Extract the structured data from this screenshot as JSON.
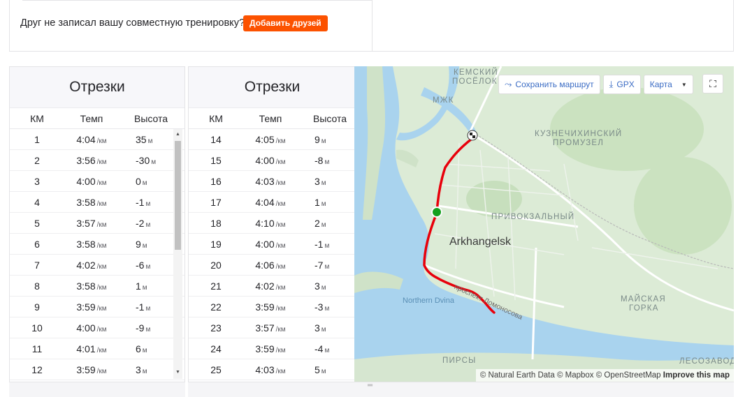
{
  "friend": {
    "prompt": "Друг не записал вашу совместную тренировку?",
    "button_label": "Добавить друзей"
  },
  "splits": {
    "title": "Отрезки",
    "columns": {
      "km": "КМ",
      "pace": "Темп",
      "elevation": "Высота"
    },
    "pace_unit": "/км",
    "elev_unit": "м",
    "left_rows": [
      {
        "km": "1",
        "pace": "4:04",
        "elev": "35"
      },
      {
        "km": "2",
        "pace": "3:56",
        "elev": "-30"
      },
      {
        "km": "3",
        "pace": "4:00",
        "elev": "0"
      },
      {
        "km": "4",
        "pace": "3:58",
        "elev": "-1"
      },
      {
        "km": "5",
        "pace": "3:57",
        "elev": "-2"
      },
      {
        "km": "6",
        "pace": "3:58",
        "elev": "9"
      },
      {
        "km": "7",
        "pace": "4:02",
        "elev": "-6"
      },
      {
        "km": "8",
        "pace": "3:58",
        "elev": "1"
      },
      {
        "km": "9",
        "pace": "3:59",
        "elev": "-1"
      },
      {
        "km": "10",
        "pace": "4:00",
        "elev": "-9"
      },
      {
        "km": "11",
        "pace": "4:01",
        "elev": "6"
      },
      {
        "km": "12",
        "pace": "3:59",
        "elev": "3"
      }
    ],
    "right_rows": [
      {
        "km": "14",
        "pace": "4:05",
        "elev": "9"
      },
      {
        "km": "15",
        "pace": "4:00",
        "elev": "-8"
      },
      {
        "km": "16",
        "pace": "4:03",
        "elev": "3"
      },
      {
        "km": "17",
        "pace": "4:04",
        "elev": "1"
      },
      {
        "km": "18",
        "pace": "4:10",
        "elev": "2"
      },
      {
        "km": "19",
        "pace": "4:00",
        "elev": "-1"
      },
      {
        "km": "20",
        "pace": "4:06",
        "elev": "-7"
      },
      {
        "km": "21",
        "pace": "4:02",
        "elev": "3"
      },
      {
        "km": "22",
        "pace": "3:59",
        "elev": "-3"
      },
      {
        "km": "23",
        "pace": "3:57",
        "elev": "3"
      },
      {
        "km": "24",
        "pace": "3:59",
        "elev": "-4"
      },
      {
        "km": "25",
        "pace": "4:03",
        "elev": "5"
      }
    ]
  },
  "map": {
    "save_route_label": "Сохранить маршрут",
    "gpx_label": "GPX",
    "map_type_label": "Карта",
    "city": "Arkhangelsk",
    "river": "Northern Dvina",
    "road": "проспект Ломоносова",
    "districts": {
      "kemsky_1": "Кемский",
      "kemsky_2": "посёлок",
      "mzhk": "МЖК",
      "kuzn_1": "Кузнечихинский",
      "kuzn_2": "промузел",
      "privokzal": "Привокзальный",
      "mayskaya_1": "Майская",
      "mayskaya_2": "горка",
      "pirsy": "Пирсы",
      "lesozavod": "Лесозавод"
    },
    "attribution": {
      "text": "© Natural Earth Data © Mapbox © OpenStreetMap",
      "improve": "Improve this map"
    },
    "colors": {
      "route": "#e8000b",
      "start_marker": "#14a01e",
      "water": "#a9d3ee",
      "land": "#dcebd6",
      "accent": "#fc5200"
    }
  }
}
